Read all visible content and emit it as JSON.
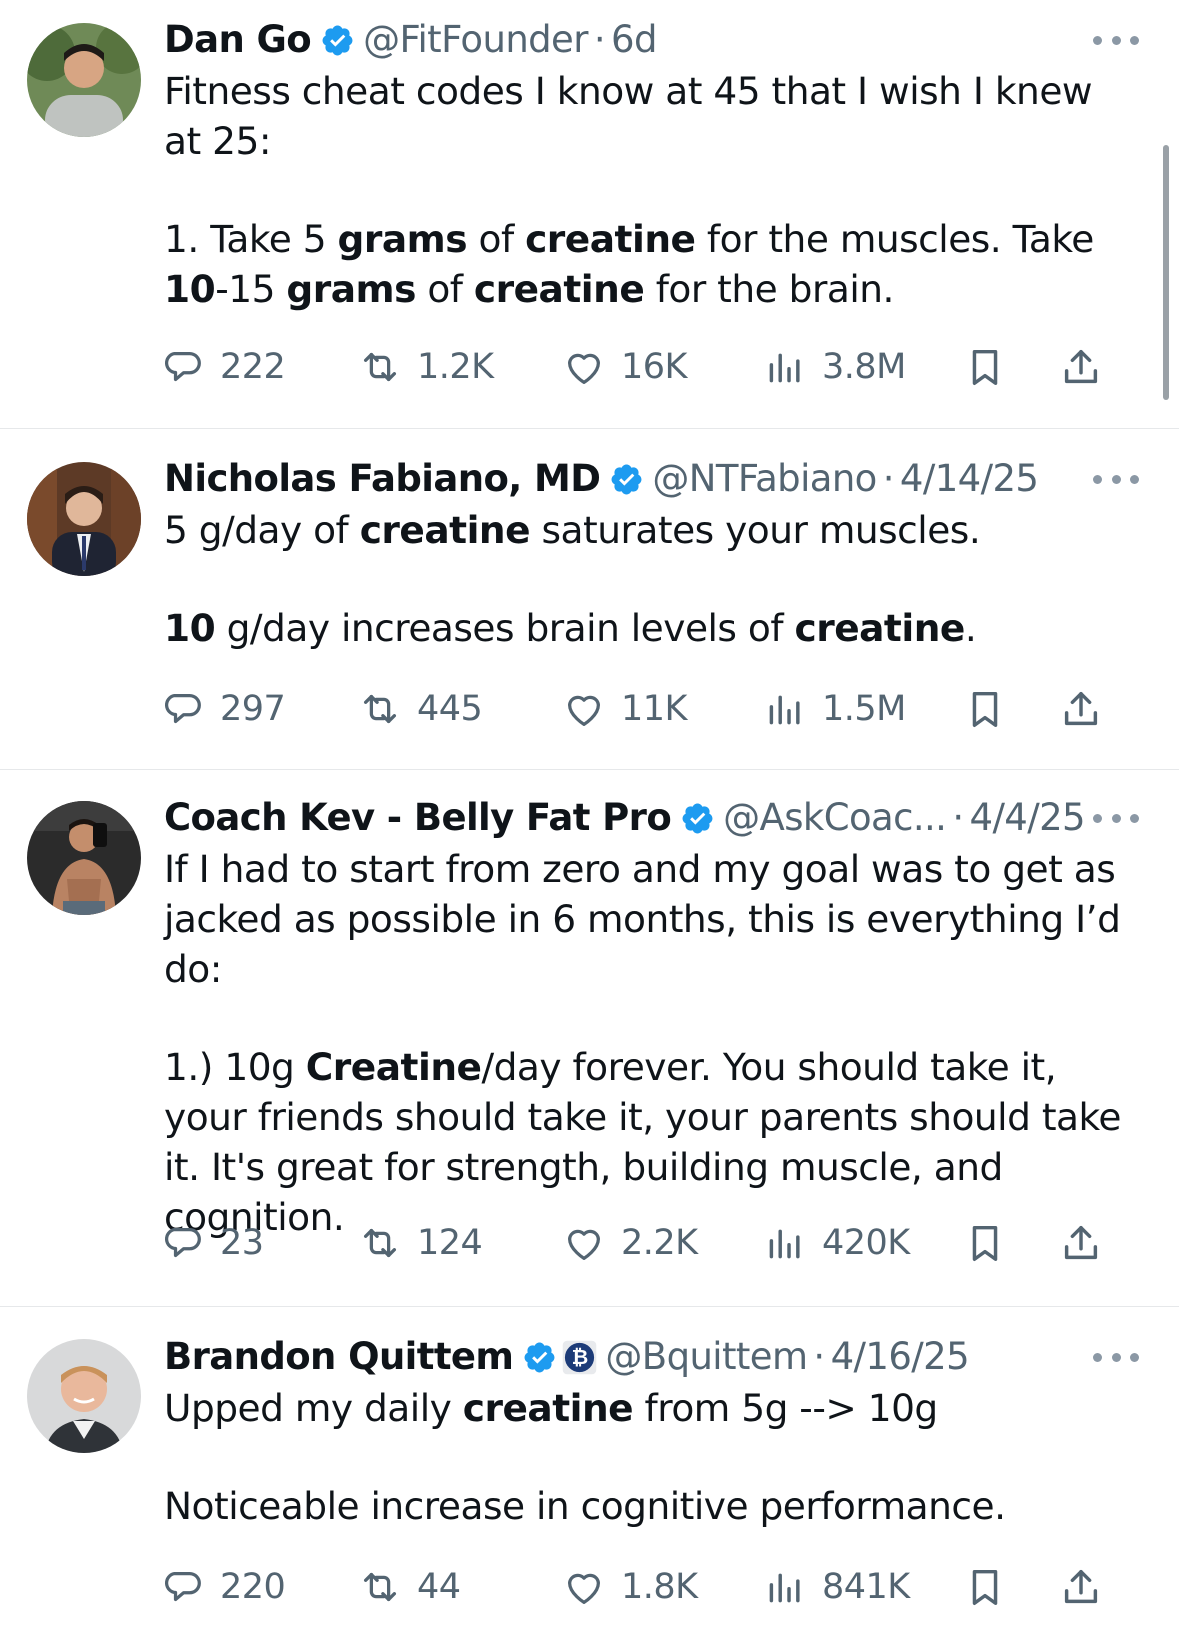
{
  "tweets": [
    {
      "name": "Dan Go",
      "handle": "@FitFounder",
      "date": "6d",
      "paragraphs": [
        [
          {
            "t": "Fitness cheat codes I know at 45 that I wish I knew at 25:",
            "b": false
          }
        ],
        [
          {
            "t": "1. Take 5 ",
            "b": false
          },
          {
            "t": "grams",
            "b": true
          },
          {
            "t": " of ",
            "b": false
          },
          {
            "t": "creatine",
            "b": true
          },
          {
            "t": " for the muscles. Take ",
            "b": false
          },
          {
            "t": "10",
            "b": true
          },
          {
            "t": "-15 ",
            "b": false
          },
          {
            "t": "grams",
            "b": true
          },
          {
            "t": " of ",
            "b": false
          },
          {
            "t": "creatine",
            "b": true
          },
          {
            "t": " for the brain.",
            "b": false
          }
        ]
      ],
      "stats": {
        "replies": "222",
        "reposts": "1.2K",
        "likes": "16K",
        "views": "3.8M"
      }
    },
    {
      "name": "Nicholas Fabiano, MD",
      "handle": "@NTFabiano",
      "date": "4/14/25",
      "paragraphs": [
        [
          {
            "t": "5 g/day of ",
            "b": false
          },
          {
            "t": "creatine",
            "b": true
          },
          {
            "t": " saturates your muscles.",
            "b": false
          }
        ],
        [
          {
            "t": "10",
            "b": true
          },
          {
            "t": " g/day increases brain levels of ",
            "b": false
          },
          {
            "t": "creatine",
            "b": true
          },
          {
            "t": ".",
            "b": false
          }
        ]
      ],
      "stats": {
        "replies": "297",
        "reposts": "445",
        "likes": "11K",
        "views": "1.5M"
      }
    },
    {
      "name": "Coach Kev - Belly Fat Pro",
      "handle": "@AskCoac...",
      "date": "4/4/25",
      "paragraphs": [
        [
          {
            "t": "If I had to start from zero and my goal was to get as jacked as possible in 6 months, this is everything I’d do:",
            "b": false
          }
        ],
        [
          {
            "t": "1.) 10g ",
            "b": false
          },
          {
            "t": "Creatine",
            "b": true
          },
          {
            "t": "/day forever. You should take it, your friends should take it, your parents should take it. It's great for strength, building muscle, and cognition.",
            "b": false
          }
        ]
      ],
      "stats": {
        "replies": "23",
        "reposts": "124",
        "likes": "2.2K",
        "views": "420K"
      }
    },
    {
      "name": "Brandon Quittem",
      "handle": "@Bquittem",
      "date": "4/16/25",
      "paragraphs": [
        [
          {
            "t": "Upped my daily ",
            "b": false
          },
          {
            "t": "creatine",
            "b": true
          },
          {
            "t": " from 5g --> 10g",
            "b": false
          }
        ],
        [
          {
            "t": "Noticeable increase in cognitive performance.",
            "b": false
          }
        ]
      ],
      "stats": {
        "replies": "220",
        "reposts": "44",
        "likes": "1.8K",
        "views": "841K"
      }
    }
  ],
  "separator": "·",
  "colors": {
    "verified": "#1d9bf0",
    "muted": "#536471",
    "text": "#0f1419",
    "divider": "#e6e8ea",
    "btc": "#1d3c78"
  },
  "icons": {
    "reply": "reply-icon",
    "repost": "repost-icon",
    "like": "heart-icon",
    "views": "views-icon",
    "bookmark": "bookmark-icon",
    "share": "share-icon",
    "more": "more-icon",
    "verified": "verified-badge-icon",
    "btc": "bitcoin-badge-icon"
  }
}
